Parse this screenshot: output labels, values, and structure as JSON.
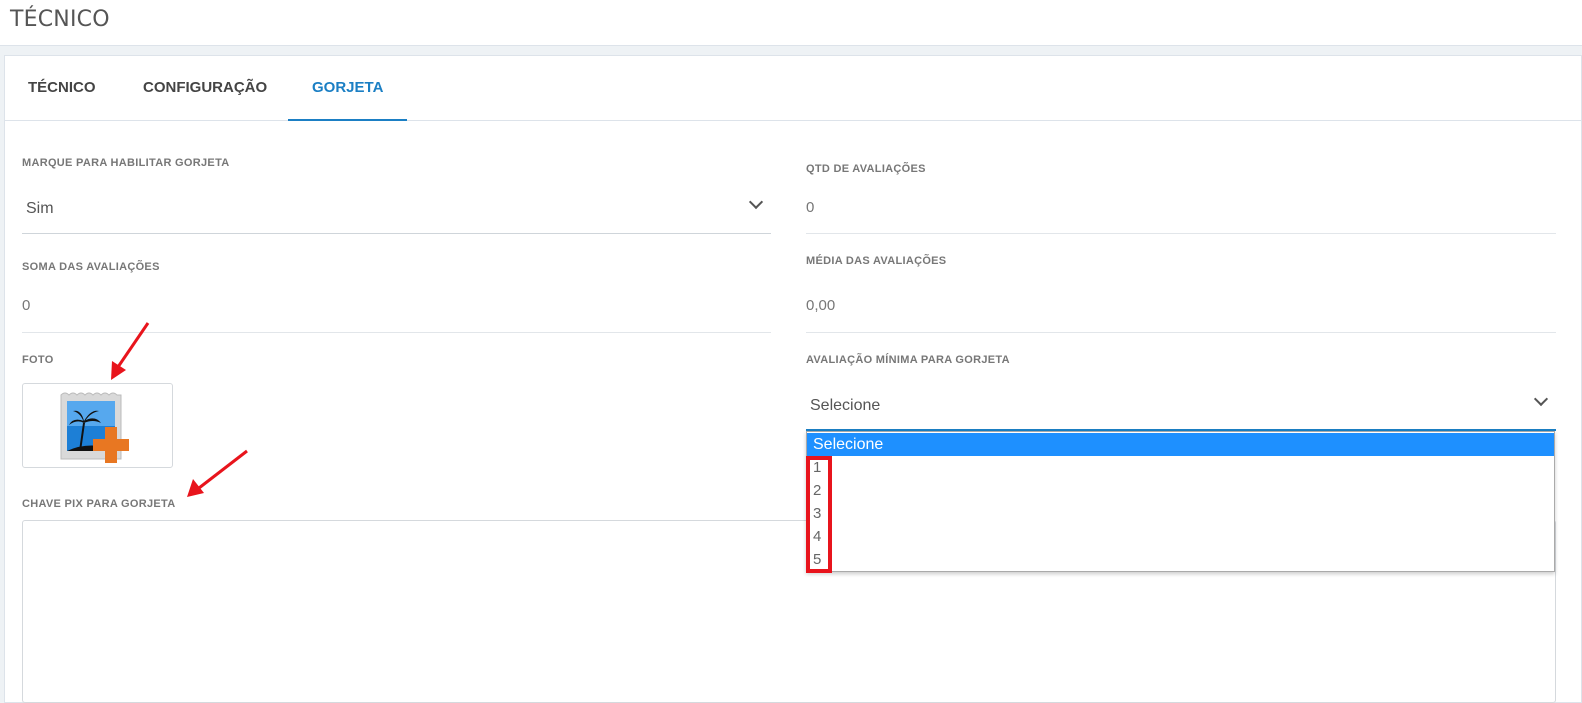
{
  "page": {
    "title": "TÉCNICO"
  },
  "tabs": [
    {
      "label": "TÉCNICO"
    },
    {
      "label": "CONFIGURAÇÃO"
    },
    {
      "label": "GORJETA"
    }
  ],
  "form": {
    "habilitar": {
      "label": "MARQUE PARA HABILITAR GORJETA",
      "value": "Sim"
    },
    "qtd": {
      "label": "QTD DE AVALIAÇÕES",
      "value": "0"
    },
    "soma": {
      "label": "SOMA DAS AVALIAÇÕES",
      "value": "0"
    },
    "media": {
      "label": "MÉDIA DAS AVALIAÇÕES",
      "value": "0,00"
    },
    "foto": {
      "label": "FOTO"
    },
    "avaliacao_minima": {
      "label": "AVALIAÇÃO MÍNIMA PARA GORJETA",
      "value": "Selecione",
      "options": [
        "Selecione",
        "1",
        "2",
        "3",
        "4",
        "5"
      ]
    },
    "chave_pix": {
      "label": "CHAVE PIX PARA GORJETA",
      "value": ""
    }
  },
  "colors": {
    "accent": "#1b7fc4",
    "dropdown_selected": "#1e90ff",
    "annotation_red": "#e8141c"
  },
  "icons": {
    "photo_upload": "add-photo-icon",
    "select_chevron": "chevron-down-icon",
    "annotation_arrow": "red-arrow-icon"
  }
}
